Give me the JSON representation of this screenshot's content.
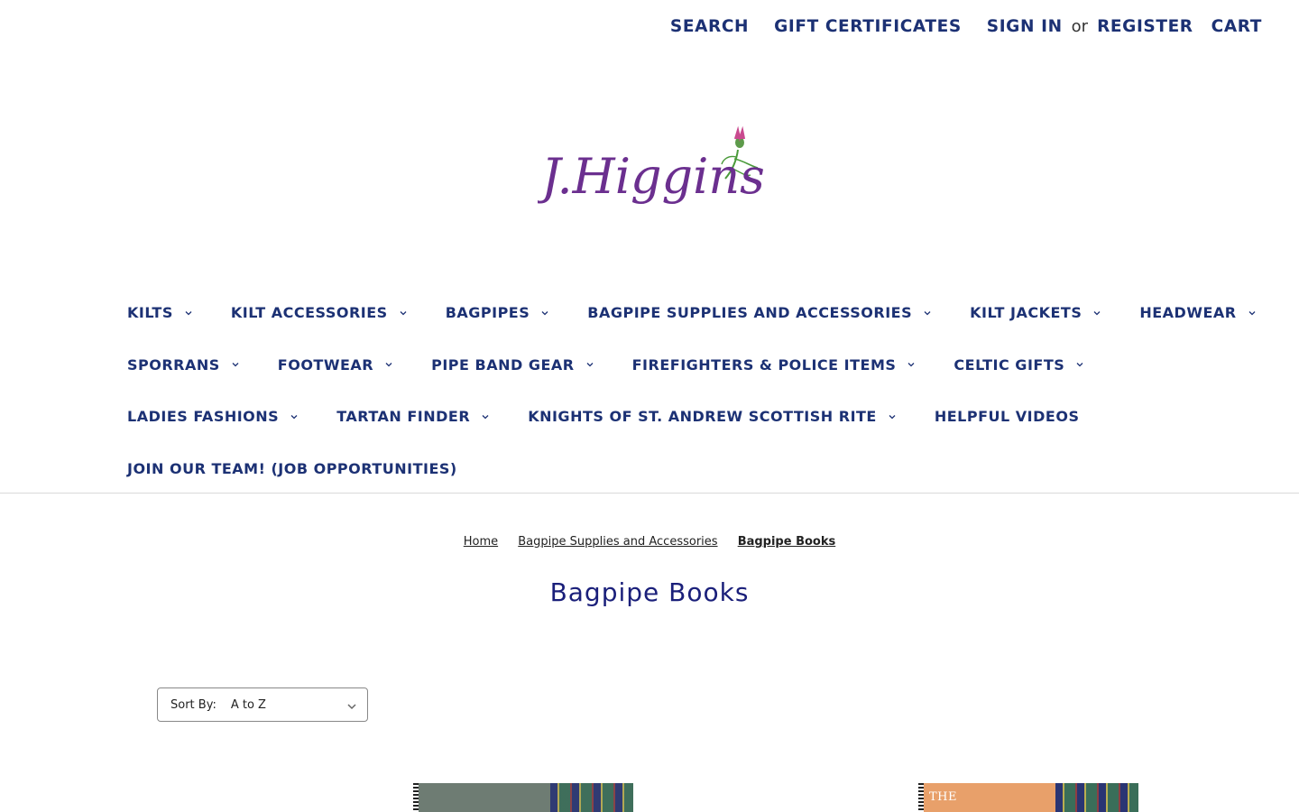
{
  "top_nav": {
    "search": "SEARCH",
    "gift_certificates": "GIFT CERTIFICATES",
    "sign_in": "SIGN IN",
    "or": "or",
    "register": "REGISTER",
    "cart": "CART"
  },
  "logo": {
    "text": "J.Higgins",
    "color": "#6b2f8f"
  },
  "main_nav": {
    "rows": [
      [
        {
          "label": "KILTS",
          "dropdown": true
        },
        {
          "label": "KILT ACCESSORIES",
          "dropdown": true
        },
        {
          "label": "BAGPIPES",
          "dropdown": true
        },
        {
          "label": "BAGPIPE SUPPLIES AND ACCESSORIES",
          "dropdown": true
        },
        {
          "label": "KILT JACKETS",
          "dropdown": true
        },
        {
          "label": "HEADWEAR",
          "dropdown": true
        }
      ],
      [
        {
          "label": "SPORRANS",
          "dropdown": true
        },
        {
          "label": "FOOTWEAR",
          "dropdown": true
        },
        {
          "label": "PIPE BAND GEAR",
          "dropdown": true
        },
        {
          "label": "FIREFIGHTERS & POLICE ITEMS",
          "dropdown": true
        },
        {
          "label": "CELTIC GIFTS",
          "dropdown": true
        }
      ],
      [
        {
          "label": "LADIES FASHIONS",
          "dropdown": true
        },
        {
          "label": "TARTAN FINDER",
          "dropdown": true
        },
        {
          "label": "KNIGHTS OF ST. ANDREW SCOTTISH RITE",
          "dropdown": true
        },
        {
          "label": "HELPFUL VIDEOS",
          "dropdown": false
        }
      ],
      [
        {
          "label": "JOIN OUR TEAM! (JOB OPPORTUNITIES)",
          "dropdown": false
        }
      ]
    ]
  },
  "breadcrumb": {
    "items": [
      "Home",
      "Bagpipe Supplies and Accessories",
      "Bagpipe Books"
    ]
  },
  "page_title": "Bagpipe Books",
  "sort": {
    "label": "Sort By:",
    "value": "A to Z"
  },
  "products": [
    {
      "cover_text": ""
    },
    {
      "cover_text": "THE"
    }
  ],
  "colors": {
    "nav": "#1c3174",
    "title": "#1a1f7a",
    "logo": "#6b2f8f"
  }
}
